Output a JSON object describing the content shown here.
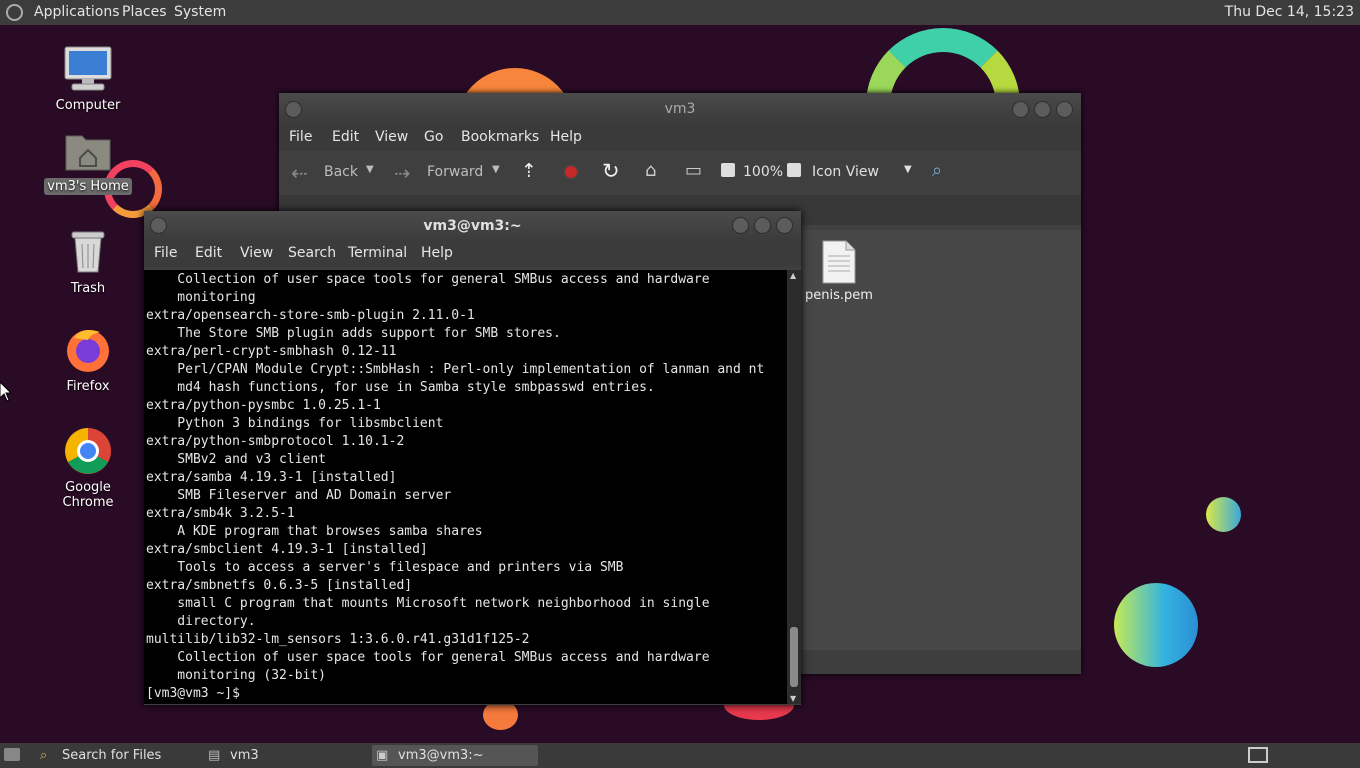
{
  "top_panel": {
    "menus": [
      "Applications",
      "Places",
      "System"
    ],
    "clock": "Thu Dec 14, 15:23"
  },
  "desktop_icons": [
    {
      "label": "Computer",
      "icon": "computer-icon"
    },
    {
      "label": "vm3's Home",
      "icon": "home-folder-icon"
    },
    {
      "label": "Trash",
      "icon": "trash-icon"
    },
    {
      "label": "Firefox",
      "icon": "firefox-icon"
    },
    {
      "label": "Google Chrome",
      "icon": "chrome-icon"
    }
  ],
  "file_manager": {
    "title": "vm3",
    "menus": [
      "File",
      "Edit",
      "View",
      "Go",
      "Bookmarks",
      "Help"
    ],
    "toolbar": {
      "back": "Back",
      "forward": "Forward",
      "zoom": "100%",
      "view_mode": "Icon View"
    },
    "files": [
      {
        "name": "penis.pem",
        "icon": "document-icon"
      }
    ]
  },
  "terminal": {
    "title": "vm3@vm3:~",
    "menus": [
      "File",
      "Edit",
      "View",
      "Search",
      "Terminal",
      "Help"
    ],
    "lines": [
      "    Collection of user space tools for general SMBus access and hardware",
      "    monitoring",
      "extra/opensearch-store-smb-plugin 2.11.0-1",
      "    The Store SMB plugin adds support for SMB stores.",
      "extra/perl-crypt-smbhash 0.12-11",
      "    Perl/CPAN Module Crypt::SmbHash : Perl-only implementation of lanman and nt",
      "    md4 hash functions, for use in Samba style smbpasswd entries.",
      "extra/python-pysmbc 1.0.25.1-1",
      "    Python 3 bindings for libsmbclient",
      "extra/python-smbprotocol 1.10.1-2",
      "    SMBv2 and v3 client",
      "extra/samba 4.19.3-1 [installed]",
      "    SMB Fileserver and AD Domain server",
      "extra/smb4k 3.2.5-1",
      "    A KDE program that browses samba shares",
      "extra/smbclient 4.19.3-1 [installed]",
      "    Tools to access a server's filespace and printers via SMB",
      "extra/smbnetfs 0.6.3-5 [installed]",
      "    small C program that mounts Microsoft network neighborhood in single",
      "    directory.",
      "multilib/lib32-lm_sensors 1:3.6.0.r41.g31d1f125-2",
      "    Collection of user space tools for general SMBus access and hardware",
      "    monitoring (32-bit)",
      "[vm3@vm3 ~]$ "
    ]
  },
  "bottom_panel": {
    "tasks": [
      {
        "label": "Search for Files",
        "icon": "search-icon"
      },
      {
        "label": "vm3",
        "icon": "folder-icon"
      },
      {
        "label": "vm3@vm3:~",
        "icon": "terminal-icon",
        "active": true
      }
    ]
  }
}
